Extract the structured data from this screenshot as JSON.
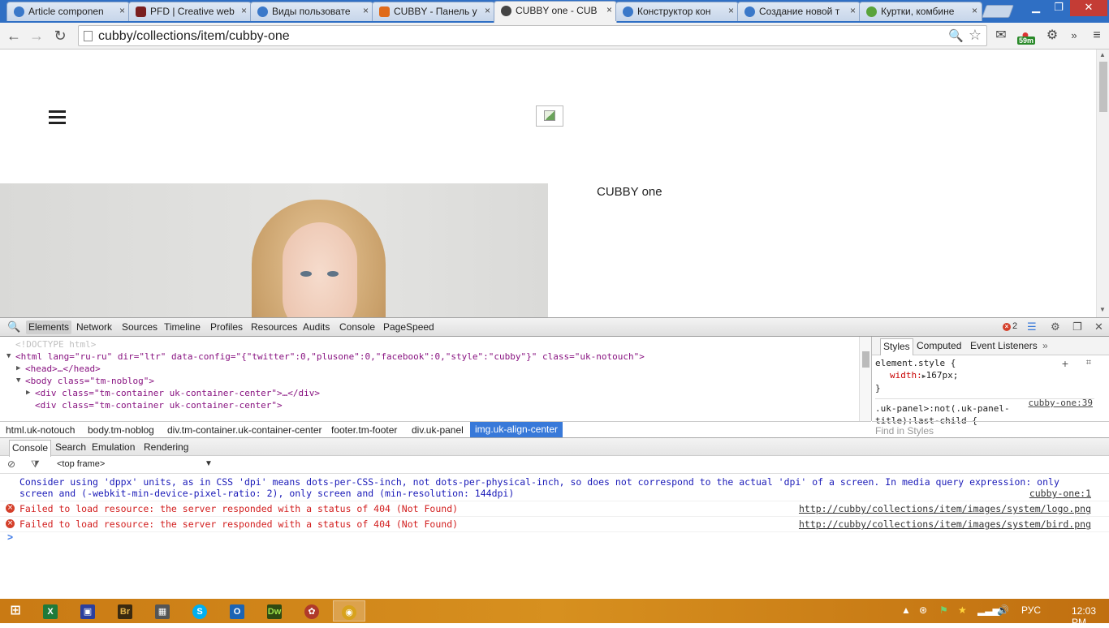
{
  "browser": {
    "tabs": [
      {
        "title": "Article componen",
        "icon": "joomla-icon",
        "color": "#3a78c9"
      },
      {
        "title": "PFD | Creative web",
        "icon": "pfd-icon",
        "color": "#7a1f1f"
      },
      {
        "title": "Виды пользовате",
        "icon": "joomla-icon",
        "color": "#3a78c9"
      },
      {
        "title": "CUBBY - Панель у",
        "icon": "cubby-icon",
        "color": "#e06b1a"
      },
      {
        "title": "CUBBY one - CUB",
        "icon": "bird-icon",
        "color": "#444444"
      },
      {
        "title": "Конструктор кон",
        "icon": "joomla-icon",
        "color": "#3a78c9"
      },
      {
        "title": "Создание новой т",
        "icon": "joomla-icon",
        "color": "#3a78c9"
      },
      {
        "title": "Куртки, комбине",
        "icon": "leaf-icon",
        "color": "#5aa33b"
      }
    ],
    "tab_close_glyph": "×",
    "url": "cubby/collections/item/cubby-one",
    "ext_badge": "59m"
  },
  "page": {
    "product_title": "CUBBY one"
  },
  "devtools": {
    "tabs": [
      "Elements",
      "Network",
      "Sources",
      "Timeline",
      "Profiles",
      "Resources",
      "Audits",
      "Console",
      "PageSpeed"
    ],
    "active_tab": "Elements",
    "error_count": "2",
    "dom": {
      "doctype": "<!DOCTYPE html>",
      "html_open": "<html lang=\"ru-ru\" dir=\"ltr\" data-config=\"{\"twitter\":0,\"plusone\":0,\"facebook\":0,\"style\":\"cubby\"}\" class=\"uk-notouch\">",
      "head": "<head>…</head>",
      "body": "<body class=\"tm-noblog\">",
      "div1": "<div class=\"tm-container uk-container-center\">…</div>",
      "div2": "<div class=\"tm-container uk-container-center\">"
    },
    "styles": {
      "tabs": [
        "Styles",
        "Computed",
        "Event Listeners"
      ],
      "element_style": "element.style {",
      "width_prop": "width:",
      "width_val": "167px;",
      "close_brace": "}",
      "rule_selector_1": ".uk-panel>:not(.uk-panel-",
      "rule_selector_2": "title):last-child {",
      "rule_source": "cubby-one:39",
      "find_placeholder": "Find in Styles"
    },
    "breadcrumbs": [
      "html.uk-notouch",
      "body.tm-noblog",
      "div.tm-container.uk-container-center",
      "footer.tm-footer",
      "div.uk-panel",
      "img.uk-align-center"
    ],
    "drawer_tabs": [
      "Console",
      "Search",
      "Emulation",
      "Rendering"
    ],
    "frame_select": "<top frame>",
    "console": {
      "warning_line1": "Consider using 'dppx' units, as in CSS 'dpi' means dots-per-CSS-inch, not dots-per-physical-inch, so does not correspond to the actual 'dpi' of a screen. In media query expression: only",
      "warning_line2": "screen and (-webkit-min-device-pixel-ratio: 2), only screen and (min-resolution: 144dpi)",
      "warning_source": "cubby-one:1",
      "errors": [
        {
          "text": "Failed to load resource: the server responded with a status of 404 (Not Found)",
          "source": "http://cubby/collections/item/images/system/logo.png"
        },
        {
          "text": "Failed to load resource: the server responded with a status of 404 (Not Found)",
          "source": "http://cubby/collections/item/images/system/bird.png"
        }
      ],
      "prompt": ">"
    }
  },
  "taskbar": {
    "apps": [
      {
        "name": "excel",
        "label": "X",
        "color": "#1f7a3a"
      },
      {
        "name": "save",
        "label": "▣",
        "color": "#2b3f9e"
      },
      {
        "name": "bridge",
        "label": "Br",
        "color": "#3a2a10"
      },
      {
        "name": "calculator",
        "label": "▦",
        "color": "#555555"
      },
      {
        "name": "skype",
        "label": "S",
        "color": "#00aff0"
      },
      {
        "name": "outlook",
        "label": "O",
        "color": "#1c64b4"
      },
      {
        "name": "dreamweaver",
        "label": "Dw",
        "color": "#2f4a12"
      },
      {
        "name": "photo",
        "label": "✿",
        "color": "#b03a2a"
      },
      {
        "name": "chrome",
        "label": "◉",
        "color": "#d8a21c"
      }
    ],
    "language": "РУС",
    "time": "12:03 PM"
  }
}
